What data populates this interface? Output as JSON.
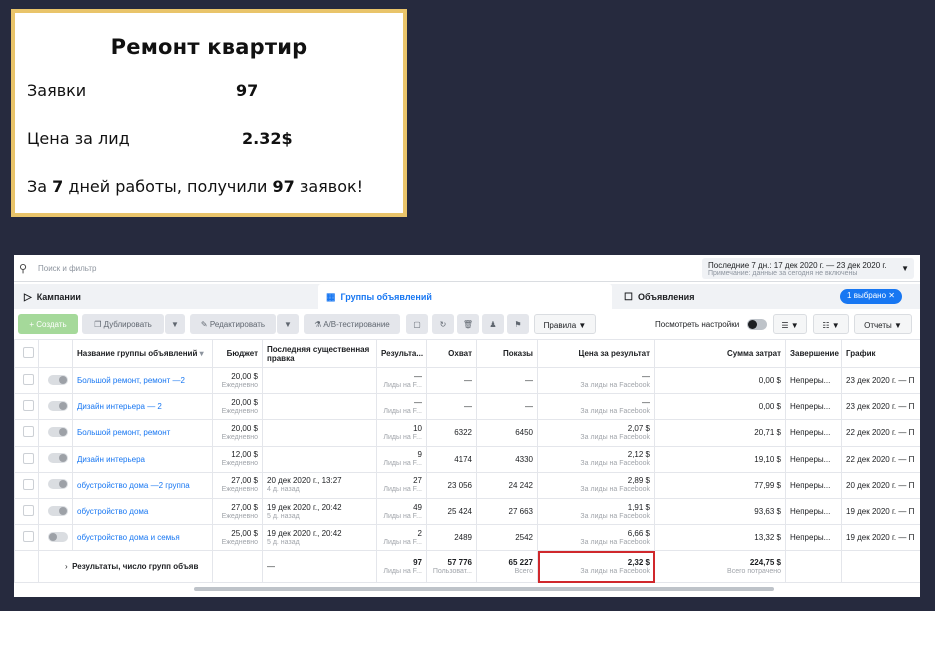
{
  "card": {
    "title": "Ремонт квартир",
    "leads_label": "Заявки",
    "leads_value": "97",
    "cpl_label": "Цена за лид",
    "cpl_value": "2.32$",
    "summary_pre": "За",
    "summary_days": "7",
    "summary_mid": "дней работы, получили",
    "summary_count": "97",
    "summary_post": "заявок!"
  },
  "ads": {
    "search_placeholder": "Поиск и фильтр",
    "date_range": "Последние 7 дн.: 17 дек 2020 г. — 23 дек 2020 г.",
    "date_note": "Примечание: данные за сегодня не включены",
    "tabs": {
      "campaigns": "Кампании",
      "adsets": "Группы объявлений",
      "ads": "Объявления",
      "selected_badge": "1 выбрано"
    },
    "toolbar": {
      "create": "Создать",
      "duplicate": "Дублировать",
      "edit": "Редактировать",
      "ab_test": "A/B-тестирование",
      "rules": "Правила",
      "view_settings": "Посмотреть настройки",
      "reports": "Отчеты"
    },
    "columns": {
      "name": "Название группы объявлений",
      "budget": "Бюджет",
      "last_edit": "Последняя существенная правка",
      "results": "Результа...",
      "reach": "Охват",
      "impressions": "Показы",
      "cost_per_result": "Цена за результат",
      "amount_spent": "Сумма затрат",
      "ends": "Завершение",
      "schedule": "График"
    },
    "rows": [
      {
        "name": "Большой ремонт, ремонт —2",
        "budget": "20,00 $",
        "budget_sub": "Ежедневно",
        "edit": "",
        "edit_sub": "",
        "results": "—",
        "results_sub": "Лиды на F...",
        "reach": "—",
        "impressions": "—",
        "cpr": "—",
        "cpr_sub": "За лиды на Facebook",
        "spent": "0,00 $",
        "ends": "Непреры...",
        "schedule": "23 дек 2020 г. — П"
      },
      {
        "name": "Дизайн интерьера — 2",
        "budget": "20,00 $",
        "budget_sub": "Ежедневно",
        "edit": "",
        "edit_sub": "",
        "results": "—",
        "results_sub": "Лиды на F...",
        "reach": "—",
        "impressions": "—",
        "cpr": "—",
        "cpr_sub": "За лиды на Facebook",
        "spent": "0,00 $",
        "ends": "Непреры...",
        "schedule": "23 дек 2020 г. — П"
      },
      {
        "name": "Большой ремонт, ремонт",
        "budget": "20,00 $",
        "budget_sub": "Ежедневно",
        "edit": "",
        "edit_sub": "",
        "results": "10",
        "results_sub": "Лиды на F...",
        "reach": "6322",
        "impressions": "6450",
        "cpr": "2,07 $",
        "cpr_sub": "За лиды на Facebook",
        "spent": "20,71 $",
        "ends": "Непреры...",
        "schedule": "22 дек 2020 г. — П"
      },
      {
        "name": "Дизайн интерьера",
        "budget": "12,00 $",
        "budget_sub": "Ежедневно",
        "edit": "",
        "edit_sub": "",
        "results": "9",
        "results_sub": "Лиды на F...",
        "reach": "4174",
        "impressions": "4330",
        "cpr": "2,12 $",
        "cpr_sub": "За лиды на Facebook",
        "spent": "19,10 $",
        "ends": "Непреры...",
        "schedule": "22 дек 2020 г. — П"
      },
      {
        "name": "обустройство дома —2 группа",
        "budget": "27,00 $",
        "budget_sub": "Ежедневно",
        "edit": "20 дек 2020 г., 13:27",
        "edit_sub": "4 д. назад",
        "results": "27",
        "results_sub": "Лиды на F...",
        "reach": "23 056",
        "impressions": "24 242",
        "cpr": "2,89 $",
        "cpr_sub": "За лиды на Facebook",
        "spent": "77,99 $",
        "ends": "Непреры...",
        "schedule": "20 дек 2020 г. — П"
      },
      {
        "name": "обустройство дома",
        "budget": "27,00 $",
        "budget_sub": "Ежедневно",
        "edit": "19 дек 2020 г., 20:42",
        "edit_sub": "5 д. назад",
        "results": "49",
        "results_sub": "Лиды на F...",
        "reach": "25 424",
        "impressions": "27 663",
        "cpr": "1,91 $",
        "cpr_sub": "За лиды на Facebook",
        "spent": "93,63 $",
        "ends": "Непреры...",
        "schedule": "19 дек 2020 г. — П"
      },
      {
        "name": "обустройство дома и семья",
        "budget": "25,00 $",
        "budget_sub": "Ежедневно",
        "edit": "19 дек 2020 г., 20:42",
        "edit_sub": "5 д. назад",
        "results": "2",
        "results_sub": "Лиды на F...",
        "reach": "2489",
        "impressions": "2542",
        "cpr": "6,66 $",
        "cpr_sub": "За лиды на Facebook",
        "spent": "13,32 $",
        "ends": "Непреры...",
        "schedule": "19 дек 2020 г. — П"
      }
    ],
    "totals": {
      "label": "Результаты, число групп объяв",
      "edit": "—",
      "results": "97",
      "results_sub": "Лиды на F...",
      "reach": "57 776",
      "reach_sub": "Пользоват...",
      "impressions": "65 227",
      "impressions_sub": "Всего",
      "cpr": "2,32 $",
      "cpr_sub": "За лиды на Facebook",
      "spent": "224,75 $",
      "spent_sub": "Всего потрачено"
    }
  }
}
